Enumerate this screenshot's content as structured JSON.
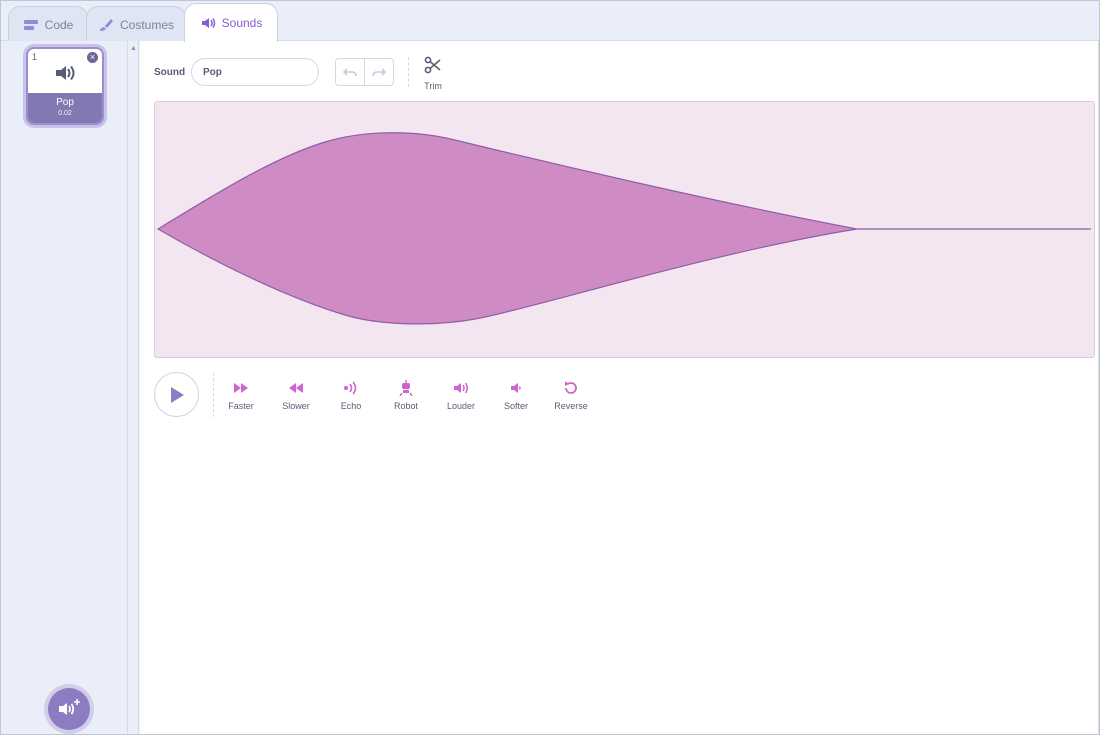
{
  "tabs": [
    {
      "label": "Code",
      "icon": "code-blocks-icon"
    },
    {
      "label": "Costumes",
      "icon": "paintbrush-icon"
    },
    {
      "label": "Sounds",
      "icon": "speaker-icon",
      "selected": true
    }
  ],
  "sound_list": {
    "items": [
      {
        "number": "1",
        "name": "Pop",
        "duration": "0.02",
        "icon": "speaker-icon",
        "selected": true
      }
    ],
    "add_button_icon": "add-sound-icon"
  },
  "editor": {
    "sound_label": "Sound",
    "sound_name": "Pop",
    "undo_icon": "undo-icon",
    "redo_icon": "redo-icon",
    "trim_label": "Trim",
    "play_icon": "play-icon",
    "effects": [
      {
        "label": "Faster",
        "icon": "faster-icon"
      },
      {
        "label": "Slower",
        "icon": "slower-icon"
      },
      {
        "label": "Echo",
        "icon": "echo-icon"
      },
      {
        "label": "Robot",
        "icon": "robot-icon"
      },
      {
        "label": "Louder",
        "icon": "louder-icon"
      },
      {
        "label": "Softer",
        "icon": "softer-icon"
      },
      {
        "label": "Reverse",
        "icon": "reverse-icon"
      }
    ]
  },
  "colors": {
    "accent": "#855cd6",
    "waveform_fill": "#cf8bc3",
    "waveform_stroke": "#8f5ea6",
    "waveform_background": "#f3e6f1",
    "effect_icon": "#cf63cf"
  }
}
